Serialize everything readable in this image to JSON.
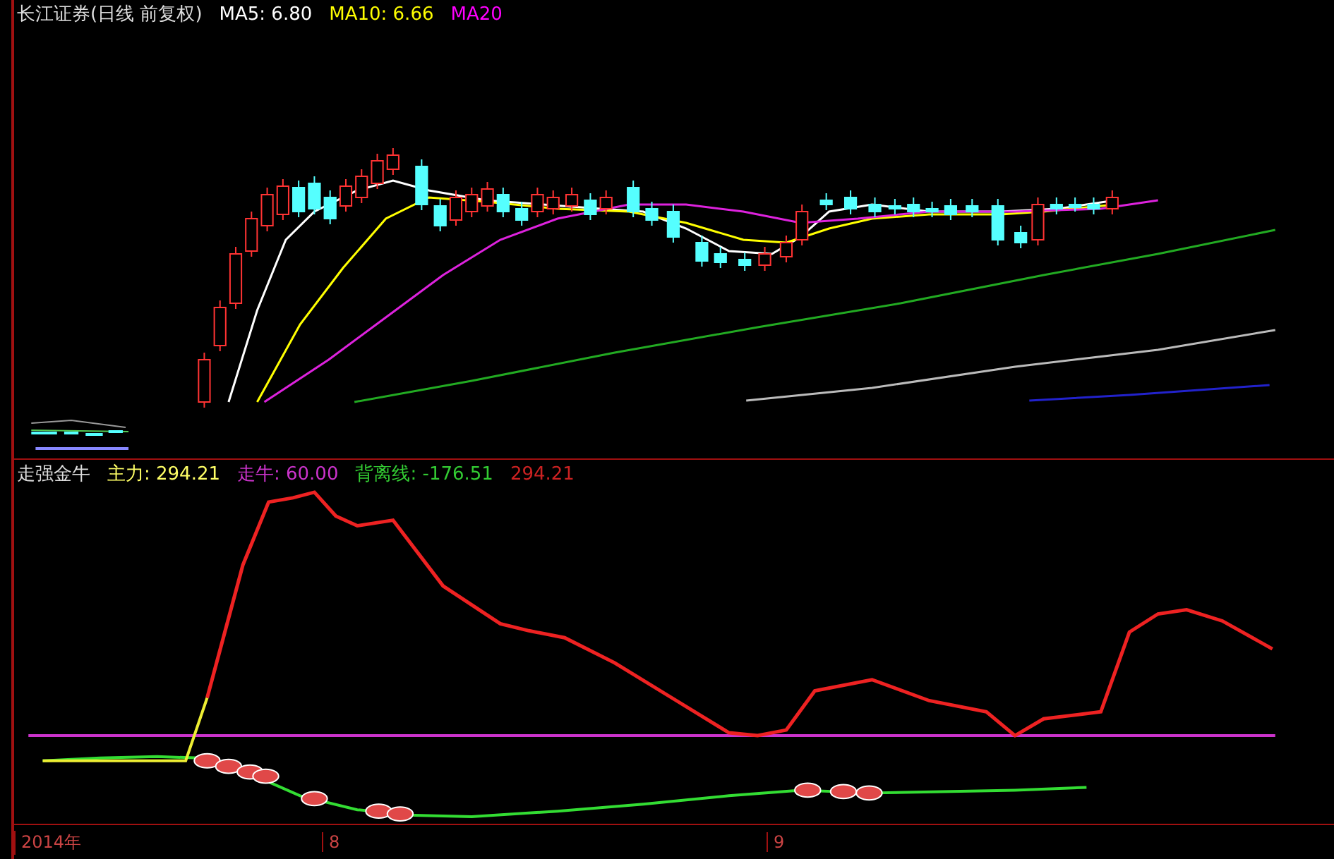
{
  "main_chart": {
    "title": "长江证券(日线 前复权)",
    "ma_labels": [
      {
        "label": "MA5: 6.80",
        "color": "#ffffff"
      },
      {
        "label": "MA10: 6.66",
        "color": "#ffff00"
      },
      {
        "label": "MA20",
        "color": "#ff00ff"
      }
    ]
  },
  "indicator": {
    "name": "走强金牛",
    "values": [
      {
        "label": "主力: 294.21",
        "color": "#ffff66"
      },
      {
        "label": "走牛: 60.00",
        "color": "#cc33cc"
      },
      {
        "label": "背离线: -176.51",
        "color": "#33cc33"
      },
      {
        "label": "294.21",
        "color": "#cc2222"
      }
    ]
  },
  "time_axis": [
    "2014年",
    "8",
    "9"
  ]
}
